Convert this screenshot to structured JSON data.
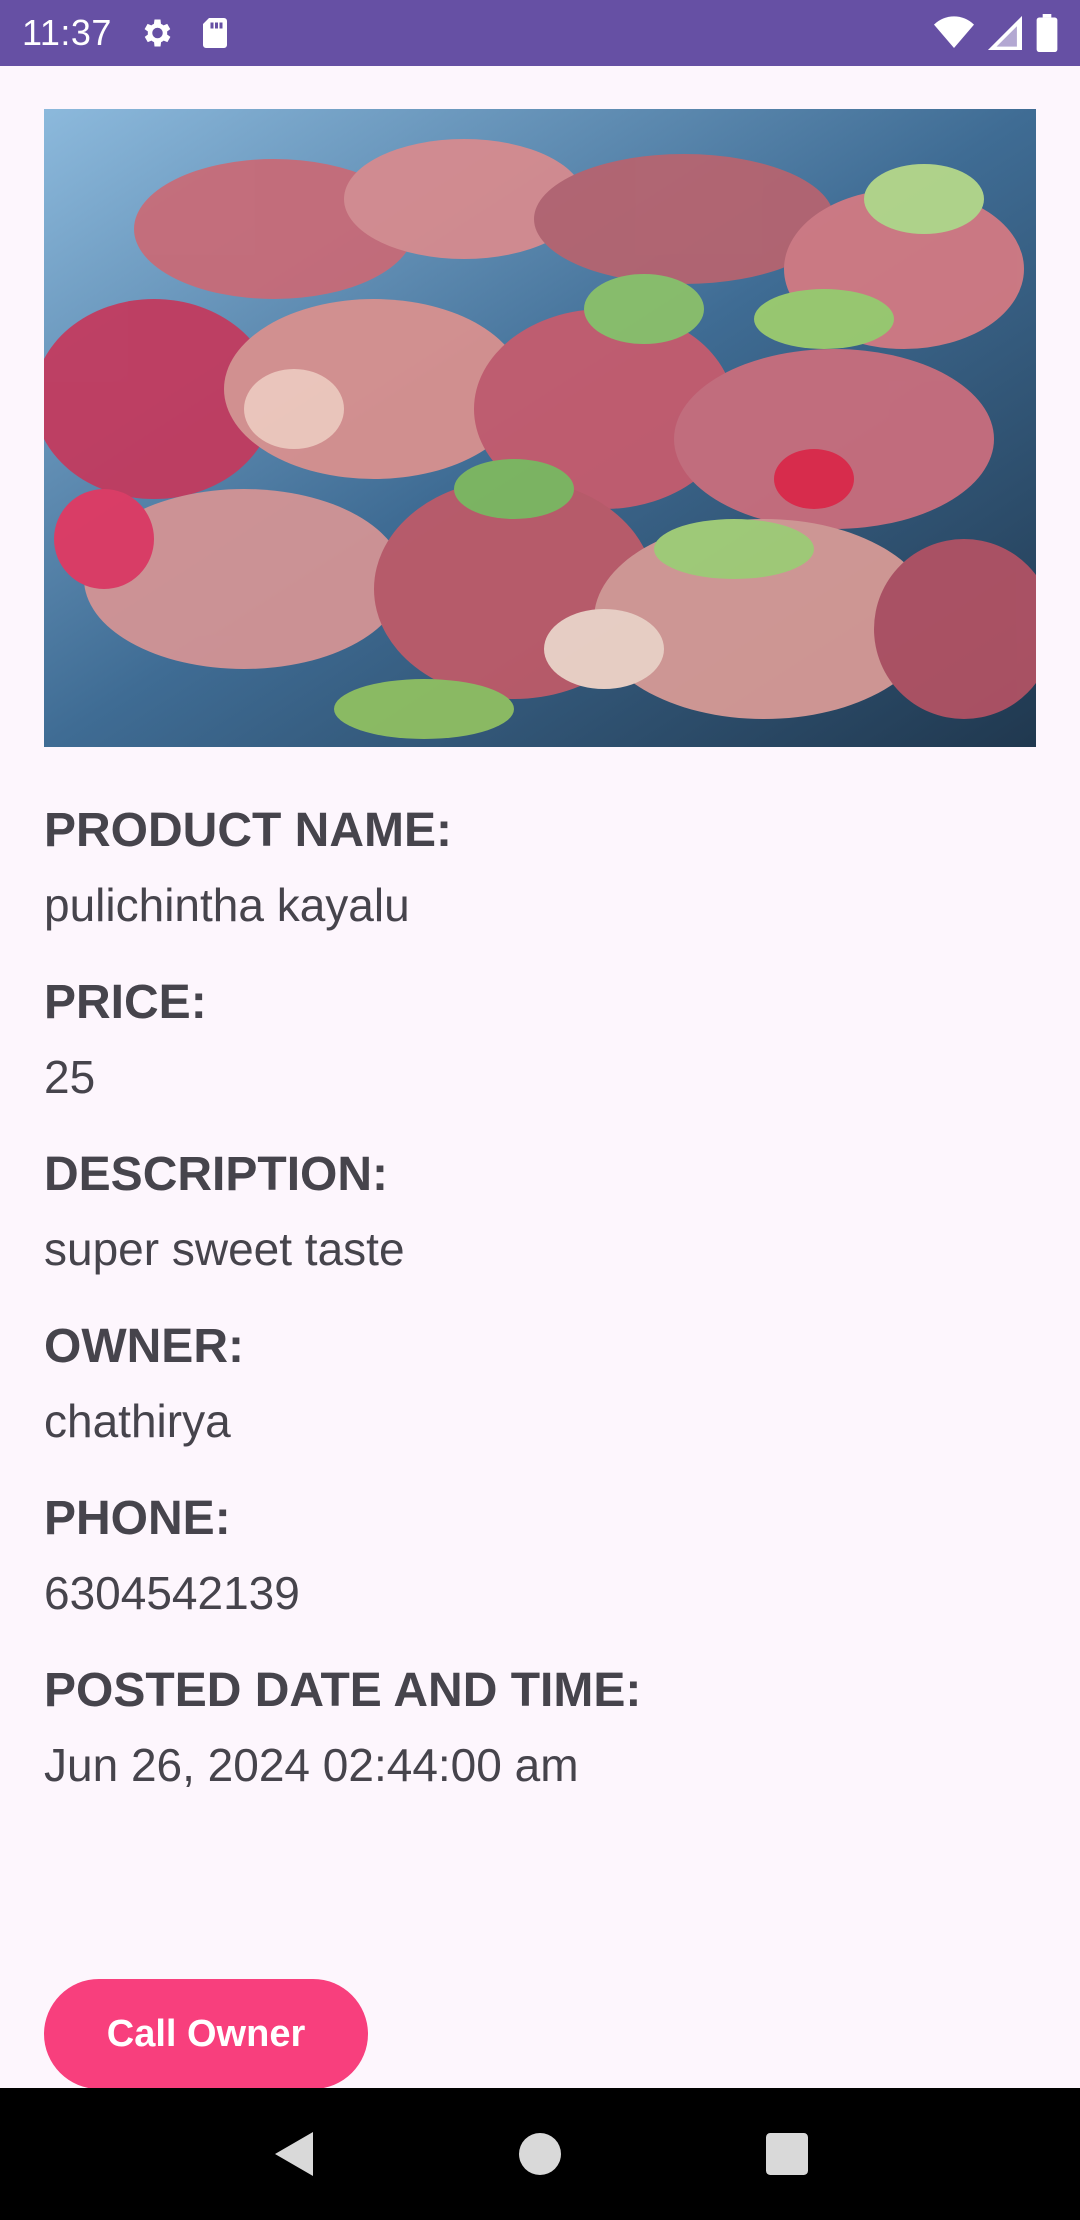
{
  "status_bar": {
    "time": "11:37",
    "icons_left": [
      "gear-icon",
      "sd-card-icon"
    ],
    "icons_right": [
      "wifi-icon",
      "signal-icon",
      "battery-icon"
    ],
    "color": "#6650a4"
  },
  "product": {
    "image_alt": "pulichintha kayalu",
    "fields": [
      {
        "label": "PRODUCT NAME:",
        "value": "pulichintha kayalu"
      },
      {
        "label": "PRICE:",
        "value": "25"
      },
      {
        "label": "DESCRIPTION:",
        "value": "super sweet taste"
      },
      {
        "label": "OWNER:",
        "value": "chathirya"
      },
      {
        "label": "PHONE:",
        "value": "6304542139"
      },
      {
        "label": "POSTED DATE AND TIME:",
        "value": "Jun 26, 2024 02:44:00 am"
      }
    ]
  },
  "actions": {
    "call_owner_label": "Call Owner",
    "call_color": "#f83f7d"
  },
  "nav_bar": {
    "buttons": [
      "back-icon",
      "home-icon",
      "recents-icon"
    ]
  }
}
